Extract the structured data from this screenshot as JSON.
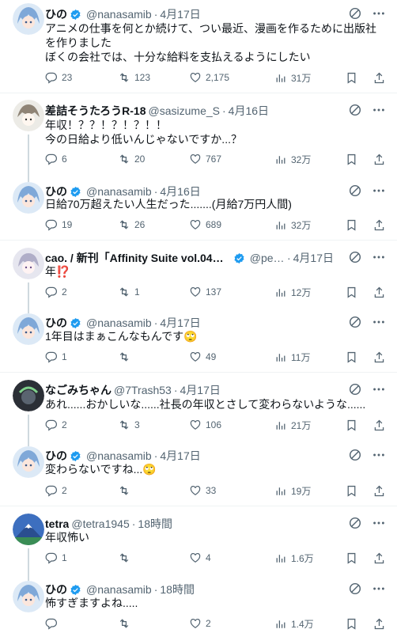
{
  "posts": [
    {
      "name": "ひの",
      "handle": "@nanasamib",
      "time": "4月17日",
      "verified": true,
      "text": "アニメの仕事を何とか続けて、つい最近、漫画を作るために出版社を作りました\nぼくの会社では、十分な給料を支払えるようにしたい",
      "replies": "23",
      "reposts": "123",
      "likes": "2,175",
      "views": "31万"
    },
    {
      "name": "差詰そうたろうR-18",
      "handle": "@sasizume_S",
      "time": "4月16日",
      "verified": false,
      "text": "年収！？？！？！？！！\n今の日給より低いんじゃないですか...？",
      "replies": "6",
      "reposts": "20",
      "likes": "767",
      "views": "32万"
    },
    {
      "name": "ひの",
      "handle": "@nanasamib",
      "time": "4月16日",
      "verified": true,
      "text": "日給70万超えたい人生だった.......(月給7万円人間)",
      "replies": "19",
      "reposts": "26",
      "likes": "689",
      "views": "32万"
    },
    {
      "name": "cao. / 新刊「Affinity Suite vol.04」4/11リ...",
      "handle": "@petit...",
      "time": "4月17日",
      "verified": true,
      "text": "年⁉️",
      "replies": "2",
      "reposts": "1",
      "likes": "137",
      "views": "12万"
    },
    {
      "name": "ひの",
      "handle": "@nanasamib",
      "time": "4月17日",
      "verified": true,
      "text": "1年目はまぁこんなもんです🙄",
      "replies": "1",
      "reposts": "",
      "likes": "49",
      "views": "11万"
    },
    {
      "name": "なごみちゃん",
      "handle": "@7Trash53",
      "time": "4月17日",
      "verified": false,
      "text": "あれ......おかしいな......社長の年収とさして変わらないような......",
      "replies": "2",
      "reposts": "3",
      "likes": "106",
      "views": "21万"
    },
    {
      "name": "ひの",
      "handle": "@nanasamib",
      "time": "4月17日",
      "verified": true,
      "text": "変わらないですね...🙄",
      "replies": "2",
      "reposts": "",
      "likes": "33",
      "views": "19万"
    },
    {
      "name": "tetra",
      "handle": "@tetra1945",
      "time": "18時間",
      "verified": false,
      "text": "年収怖い",
      "replies": "1",
      "reposts": "",
      "likes": "4",
      "views": "1.6万"
    },
    {
      "name": "ひの",
      "handle": "@nanasamib",
      "time": "18時間",
      "verified": true,
      "text": "怖すぎますよね.....",
      "replies": "",
      "reposts": "",
      "likes": "2",
      "views": "1.4万"
    }
  ],
  "colors": {
    "verified": "#1d9bf0",
    "muted": "#536471",
    "text": "#0f1419",
    "separator": "#eff3f4"
  },
  "icons": [
    "reply-icon",
    "repost-icon",
    "like-icon",
    "views-icon",
    "bookmark-icon",
    "share-icon",
    "grok-icon",
    "more-icon",
    "verified-icon"
  ]
}
